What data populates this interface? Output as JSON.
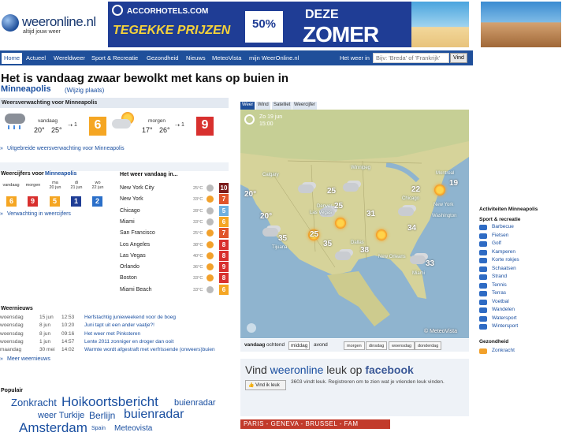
{
  "logo": {
    "name": "weeronline.nl",
    "tagline": "altijd jouw weer"
  },
  "banner": {
    "brand": "ACCORHOTELS.COM",
    "promo": "TEGEKKE PRIJZEN",
    "percent": "50%",
    "deze": "DEZE",
    "zomer": "ZOMER"
  },
  "nav": {
    "items": [
      "Home",
      "Actueel",
      "Wereldweer",
      "Sport & Recreatie",
      "Gezondheid",
      "Nieuws",
      "MeteoVista",
      "mijn WeerOnline.nl"
    ],
    "weer_in_label": "Het weer in",
    "search_placeholder": "Bijv: 'Breda' of 'Frankrijk'",
    "search_button": "Vind"
  },
  "headline": "Het is vandaag zwaar bewolkt met kans op buien in",
  "city": "Minneapolis",
  "wijzig": "(Wijzig plaats)",
  "forecast": {
    "header": "Weersverwachting voor Minneapolis",
    "today": {
      "label": "vandaag",
      "min": "20°",
      "max": "25°",
      "wind": "1",
      "bft": "6",
      "color": "#f5a623"
    },
    "tomorrow": {
      "label": "morgen",
      "min": "17°",
      "max": "26°",
      "wind": "1",
      "bft": "9",
      "color": "#d8302e"
    },
    "more_link": "Uitgebreide weersverwachting voor Minneapolis"
  },
  "weercijfers": {
    "header": "Weercijfers voor",
    "city": "Minneapolis",
    "days": [
      {
        "label": "vandaag",
        "value": "6",
        "color": "#f5a623"
      },
      {
        "label": "morgen",
        "value": "9",
        "color": "#d8302e"
      },
      {
        "label": "ma\n20 jun",
        "value": "5",
        "color": "#f5a623"
      },
      {
        "label": "di\n21 jun",
        "value": "1",
        "color": "#1f3d95"
      },
      {
        "label": "wo\n22 jun",
        "value": "2",
        "color": "#2a6fc9"
      }
    ],
    "link": "Verwachting in weercijfers"
  },
  "cities": {
    "header": "Het weer vandaag in...",
    "rows": [
      {
        "name": "New York City",
        "temp": "25°C",
        "bft": "10",
        "color": "#7a1c1c",
        "icon": "#bbb"
      },
      {
        "name": "New York",
        "temp": "33°C",
        "bft": "7",
        "color": "#e0552b",
        "icon": "#f2a12b"
      },
      {
        "name": "Chicago",
        "temp": "28°C",
        "bft": "5",
        "color": "#6db0e0",
        "icon": "#bbb"
      },
      {
        "name": "Miami",
        "temp": "33°C",
        "bft": "6",
        "color": "#f5a623",
        "icon": "#bbb"
      },
      {
        "name": "San Francisco",
        "temp": "25°C",
        "bft": "7",
        "color": "#e0552b",
        "icon": "#f2a12b"
      },
      {
        "name": "Los Angeles",
        "temp": "38°C",
        "bft": "8",
        "color": "#d8302e",
        "icon": "#f2a12b"
      },
      {
        "name": "Las Vegas",
        "temp": "40°C",
        "bft": "8",
        "color": "#d8302e",
        "icon": "#f2a12b"
      },
      {
        "name": "Orlando",
        "temp": "36°C",
        "bft": "9",
        "color": "#d8302e",
        "icon": "#f2a12b"
      },
      {
        "name": "Boston",
        "temp": "33°C",
        "bft": "8",
        "color": "#d8302e",
        "icon": "#f2a12b"
      },
      {
        "name": "Miami Beach",
        "temp": "33°C",
        "bft": "6",
        "color": "#f5a623",
        "icon": "#bbb"
      }
    ]
  },
  "news": {
    "header": "Weernieuws",
    "rows": [
      {
        "day": "woensdag",
        "date": "15 jun",
        "time": "12:53",
        "title": "Herfstachtig junieweekend voor de boeg"
      },
      {
        "day": "woensdag",
        "date": "8 jun",
        "time": "10:20",
        "title": "Juni tapt uit een ander vaatje?!"
      },
      {
        "day": "woensdag",
        "date": "8 jun",
        "time": "09:16",
        "title": "Het weer met Pinksteren"
      },
      {
        "day": "woensdag",
        "date": "1 jun",
        "time": "14:57",
        "title": "Lente 2011 zonniger en droger dan ooit"
      },
      {
        "day": "maandag",
        "date": "30 mei",
        "time": "14:02",
        "title": "Warmte wordt afgestraft met verfrissende (onweers)buien"
      }
    ],
    "more": "Meer weernieuws"
  },
  "populair": {
    "header": "Populair",
    "tags": [
      "Zonkracht",
      "Hoikoortsbericht",
      "buienradar",
      "weer Turkije",
      "Berlijn",
      "buienradar",
      "Amsterdam",
      "Spain",
      "Meteovista"
    ]
  },
  "map": {
    "tabs": [
      "Weer",
      "Wind",
      "Satelliet",
      "Weercijfer"
    ],
    "date": "Zo 19 jun",
    "time": "15:00",
    "credit": "© MeteoVista",
    "temps": [
      "20°",
      "25",
      "22",
      "19",
      "20°",
      "25",
      "31",
      "25",
      "34",
      "35",
      "35",
      "38",
      "33"
    ],
    "places": [
      "Calgary",
      "Winnipeg",
      "Chicago",
      "Las Vegas",
      "Denver",
      "Washington",
      "New York",
      "Dallas",
      "Tijuana",
      "New Orleans",
      "Miami",
      "Montreal"
    ],
    "time_buttons": [
      "vandaag",
      "ochtend",
      "middag",
      "avond"
    ],
    "day_buttons": [
      "morgen",
      "dinsdag",
      "woensdag",
      "donderdag"
    ]
  },
  "facebook": {
    "title_pre": "Vind",
    "title_brand": "weeronline",
    "title_mid": "leuk op",
    "title_fb": "facebook",
    "like": "Vind ik leuk",
    "count_text": "3603 vindt leuk. Registreren om te zien wat je vrienden leuk vinden.",
    "footer": "PARIS - GENEVA - BRUSSEL - FAM"
  },
  "activities": {
    "header": "Activiteiten Minneapolis",
    "sport_header": "Sport & recreatie",
    "items": [
      "Barbecue",
      "Fietsen",
      "Golf",
      "Kamperen",
      "Korte rokjes",
      "Schaatsen",
      "Strand",
      "Tennis",
      "Terras",
      "Voetbal",
      "Wandelen",
      "Watersport",
      "Wintersport"
    ],
    "health_header": "Gezondheid",
    "health_items": [
      "Zonkracht"
    ]
  }
}
